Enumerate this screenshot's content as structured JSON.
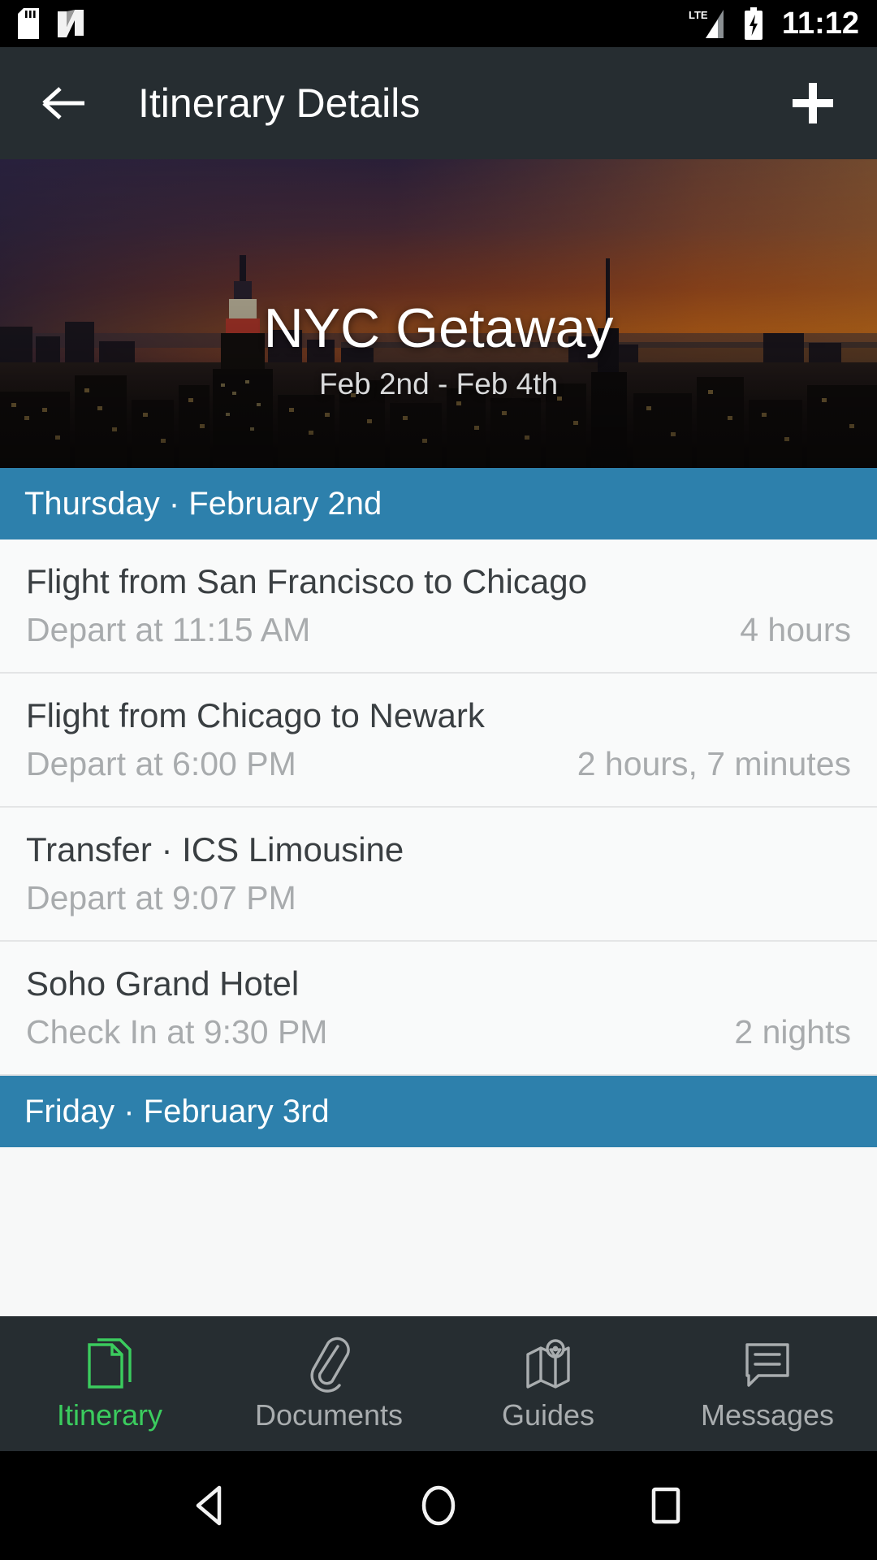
{
  "status_bar": {
    "icons": [
      "sd-card-icon",
      "nfc-icon",
      "lte-signal-icon",
      "battery-charging-icon"
    ],
    "network_label": "LTE",
    "clock": "11:12"
  },
  "app_bar": {
    "back_icon": "back-arrow-icon",
    "title": "Itinerary Details",
    "add_icon": "plus-icon"
  },
  "hero": {
    "image_description": "nyc-skyline-sunset-photo",
    "title": "NYC Getaway",
    "subtitle": "Feb 2nd - Feb 4th"
  },
  "itinerary": {
    "days": [
      {
        "header": "Thursday · February 2nd",
        "events": [
          {
            "title": "Flight from San Francisco to Chicago",
            "subtitle": "Depart at 11:15 AM",
            "meta": "4 hours"
          },
          {
            "title": "Flight from Chicago to Newark",
            "subtitle": "Depart at 6:00 PM",
            "meta": "2 hours, 7 minutes"
          },
          {
            "title": "Transfer · ICS Limousine",
            "subtitle": "Depart at 9:07 PM",
            "meta": ""
          },
          {
            "title": "Soho Grand Hotel",
            "subtitle": "Check In at 9:30 PM",
            "meta": "2 nights"
          }
        ]
      },
      {
        "header": "Friday · February 3rd",
        "events": []
      }
    ]
  },
  "tab_bar": {
    "tabs": [
      {
        "label": "Itinerary",
        "icon": "document-icon",
        "active": true
      },
      {
        "label": "Documents",
        "icon": "paperclip-icon",
        "active": false
      },
      {
        "label": "Guides",
        "icon": "map-pin-icon",
        "active": false
      },
      {
        "label": "Messages",
        "icon": "speech-bubble-icon",
        "active": false
      }
    ]
  },
  "nav_bar": {
    "back_icon": "android-back-icon",
    "home_icon": "android-home-icon",
    "recents_icon": "android-recents-icon"
  },
  "colors": {
    "app_bar": "#262d31",
    "day_header_blue": "#2d80ac",
    "active_tab_green": "#3bcc5e",
    "list_background": "#f9fafa",
    "primary_text": "#3a3f42",
    "secondary_text": "#a8abad"
  }
}
